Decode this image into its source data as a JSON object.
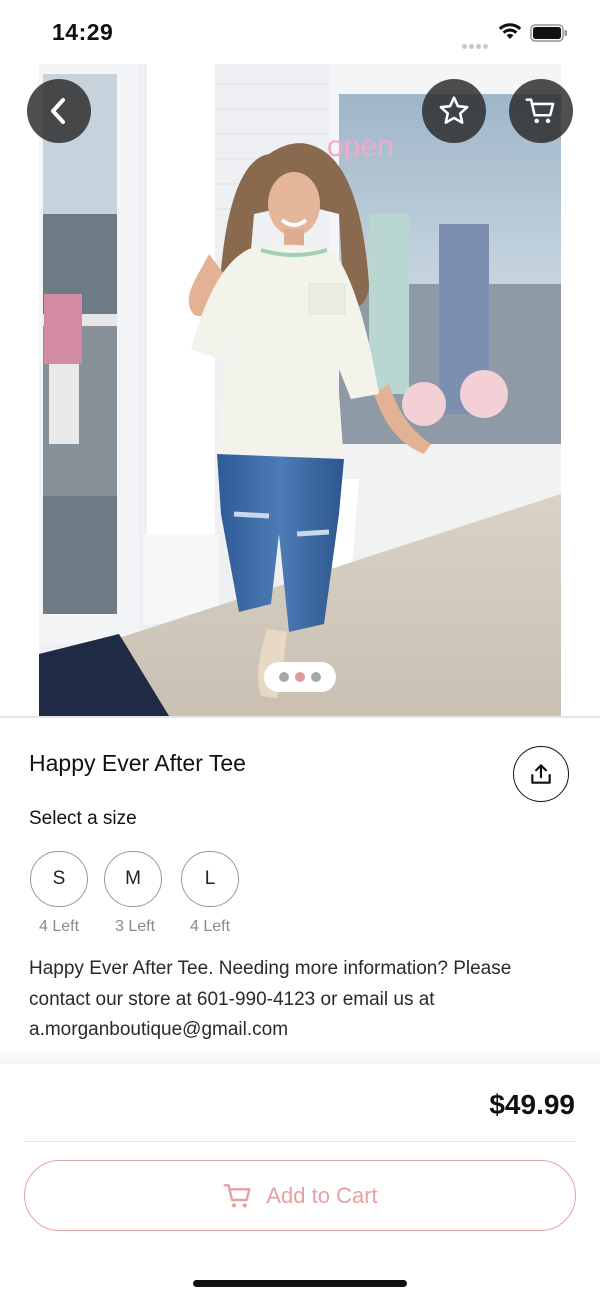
{
  "status_bar": {
    "time": "14:29"
  },
  "icons": {
    "back": "chevron-left-icon",
    "favorite": "star-icon",
    "cart": "cart-icon",
    "share": "share-icon",
    "wifi": "wifi-icon",
    "battery": "battery-icon"
  },
  "carousel": {
    "page_count": 3,
    "active_index": 1
  },
  "product": {
    "title": "Happy Ever After Tee",
    "size_heading": "Select a size",
    "sizes": [
      {
        "label": "S",
        "stock": "4 Left"
      },
      {
        "label": "M",
        "stock": "3 Left"
      },
      {
        "label": "L",
        "stock": "4 Left"
      }
    ],
    "description": "Happy Ever After Tee. Needing more information? Please contact our store at 601-990-4123 or email us at a.morganboutique@gmail.com",
    "price": "$49.99"
  },
  "footer": {
    "add_to_cart_label": "Add to Cart"
  },
  "colors": {
    "accent": "#e4a2a2",
    "pager_active": "#e39a9a"
  }
}
